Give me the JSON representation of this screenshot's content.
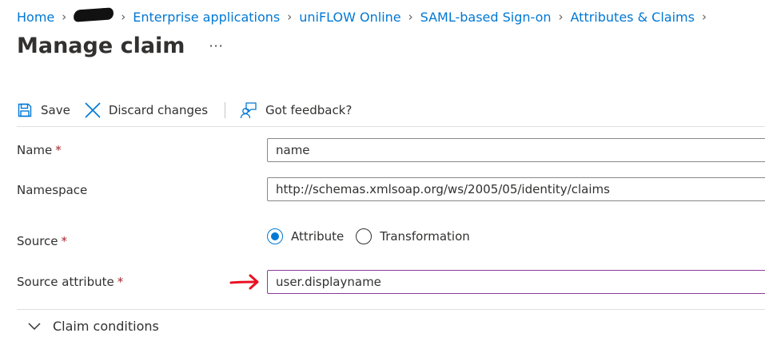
{
  "breadcrumb": {
    "items": [
      "Home",
      "Enterprise applications",
      "uniFLOW Online",
      "SAML-based Sign-on",
      "Attributes & Claims"
    ]
  },
  "page": {
    "title": "Manage claim",
    "more_label": "···"
  },
  "toolbar": {
    "save_label": "Save",
    "discard_label": "Discard changes",
    "feedback_label": "Got feedback?"
  },
  "form": {
    "name": {
      "label": "Name",
      "value": "name"
    },
    "namespace": {
      "label": "Namespace",
      "value": "http://schemas.xmlsoap.org/ws/2005/05/identity/claims"
    },
    "source": {
      "label": "Source",
      "options": [
        "Attribute",
        "Transformation"
      ],
      "selected": "Attribute"
    },
    "source_attribute": {
      "label": "Source attribute",
      "value": "user.displayname"
    },
    "required_mark": "*"
  },
  "claim_conditions": {
    "label": "Claim conditions"
  },
  "colors": {
    "accent": "#0078d4",
    "required": "#a4262c",
    "annotation_arrow": "#e81123",
    "focus_border": "#8b3b9a"
  },
  "icons": [
    "save-icon",
    "close-icon",
    "feedback-icon",
    "chevron-down-icon",
    "chevron-right-icon",
    "red-arrow-icon"
  ]
}
